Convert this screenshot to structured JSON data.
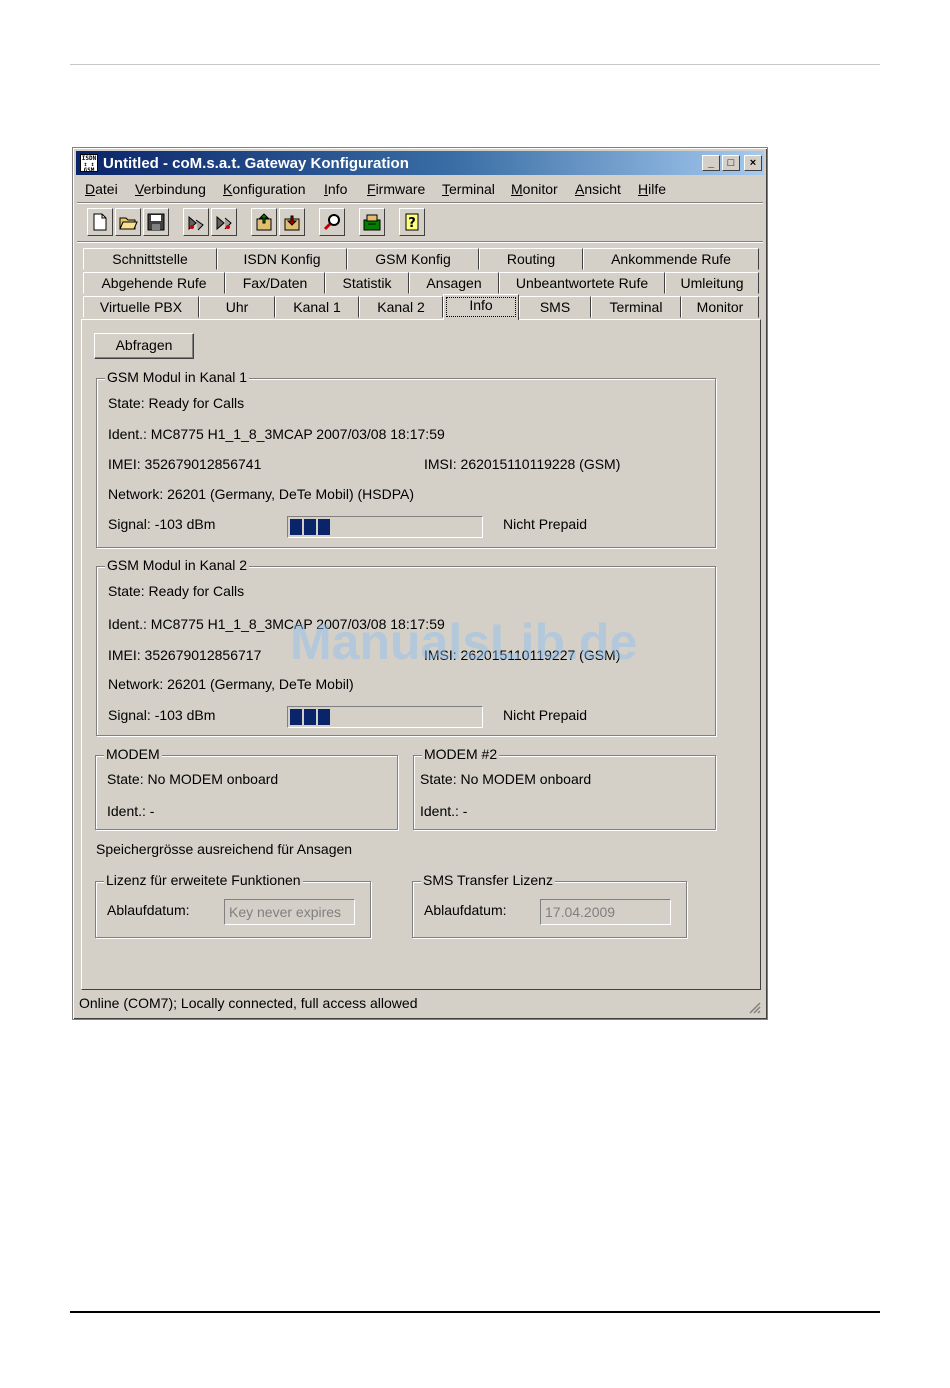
{
  "window": {
    "title": "Untitled - coM.s.a.t. Gateway Konfiguration",
    "app_icon_text": [
      "ISDN",
      "↕ ↕",
      "GSM"
    ],
    "min_glyph": "_",
    "max_glyph": "□",
    "close_glyph": "×"
  },
  "menu": [
    "Datei",
    "Verbindung",
    "Konfiguration",
    "Info",
    "Firmware",
    "Terminal",
    "Monitor",
    "Ansicht",
    "Hilfe"
  ],
  "toolbar": {
    "icons": [
      "new-file-icon",
      "open-folder-icon",
      "save-icon",
      "connect-icon",
      "disconnect-icon",
      "upload-config-icon",
      "download-config-icon",
      "search-icon",
      "firmware-icon",
      "help-icon"
    ],
    "help_glyph": "?"
  },
  "tabs": {
    "row1": [
      "Schnittstelle",
      "ISDN Konfig",
      "GSM Konfig",
      "Routing",
      "Ankommende Rufe"
    ],
    "row2": [
      "Abgehende Rufe",
      "Fax/Daten",
      "Statistik",
      "Ansagen",
      "Unbeantwortete Rufe",
      "Umleitung"
    ],
    "row3": [
      "Virtuelle PBX",
      "Uhr",
      "Kanal 1",
      "Kanal 2",
      "Info",
      "SMS",
      "Terminal",
      "Monitor"
    ],
    "active": "Info"
  },
  "info": {
    "query_button": "Abfragen",
    "gsm1": {
      "title": "GSM Modul in Kanal 1",
      "state": "State: Ready for Calls",
      "ident": "Ident.: MC8775 H1_1_8_3MCAP  2007/03/08 18:17:59",
      "imei": "IMEI: 352679012856741",
      "imsi": "IMSI: 262015110119228 (GSM)",
      "network": "Network: 26201 (Germany, DeTe Mobil) (HSDPA)",
      "signal": "Signal: -103 dBm",
      "signal_level": 3,
      "prepaid": "Nicht Prepaid"
    },
    "gsm2": {
      "title": "GSM Modul in Kanal 2",
      "state": "State: Ready for Calls",
      "ident": "Ident.: MC8775 H1_1_8_3MCAP  2007/03/08 18:17:59",
      "imei": "IMEI: 352679012856717",
      "imsi": "IMSI: 262015110119227 (GSM)",
      "network": "Network: 26201 (Germany, DeTe Mobil)",
      "signal": "Signal: -103 dBm",
      "signal_level": 3,
      "prepaid": "Nicht Prepaid"
    },
    "modem1": {
      "title": "MODEM",
      "state": "State: No MODEM onboard",
      "ident": "Ident.: -"
    },
    "modem2": {
      "title": "MODEM #2",
      "state": "State: No MODEM onboard",
      "ident": "Ident.: -"
    },
    "storage": "Speichergrösse ausreichend für Ansagen",
    "license": {
      "title": "Lizenz für erweitete Funktionen",
      "label": "Ablaufdatum:",
      "value": "Key never expires"
    },
    "sms_license": {
      "title": "SMS Transfer Lizenz",
      "label": "Ablaufdatum:",
      "value": "17.04.2009"
    }
  },
  "status": "Online (COM7); Locally connected, full access allowed",
  "watermark": "ManualsLib.de",
  "colors": {
    "title_start": "#0a246a",
    "title_end": "#a6caf0",
    "window_bg": "#d4d0c8",
    "progress": "#0a246a"
  }
}
